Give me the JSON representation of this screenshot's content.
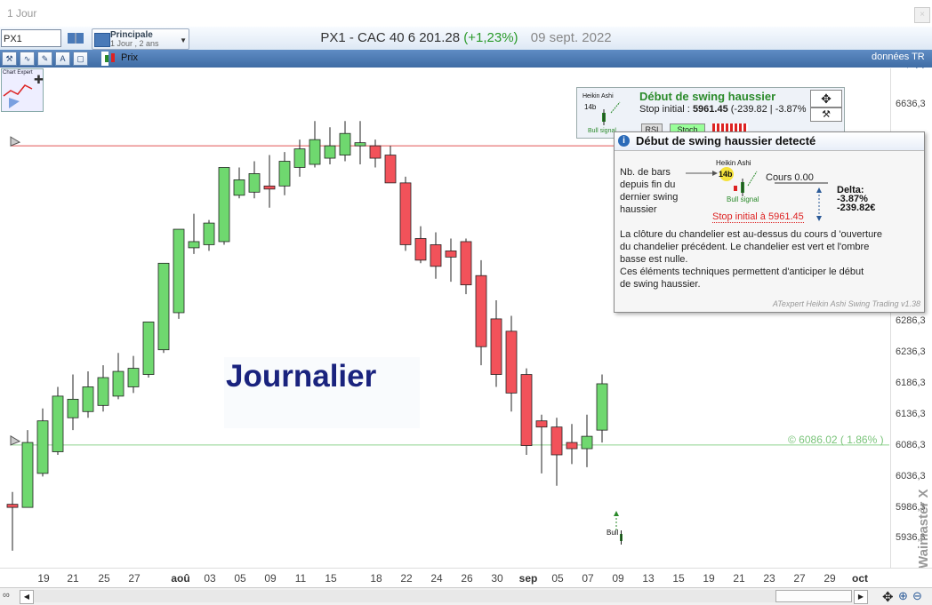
{
  "window": {
    "title": "1 Jour",
    "close_label": "×"
  },
  "toolbar": {
    "symbol": "PX1",
    "series_name": "Principale",
    "series_period": "1 Jour , 2 ans",
    "title_main": "PX1 - CAC 40  6 201.28",
    "title_change": "(+1,23%)",
    "title_date": "09 sept. 2022",
    "price_label": "Prix",
    "data_source": "données TR",
    "chart_expert_label": "Chart Expert"
  },
  "watermark": "Waimaster X",
  "annotations": {
    "journalier": "Journalier",
    "price_line_label": "© 6086.02 ( 1.86% )",
    "bull_label": "Bull"
  },
  "signal_panel": {
    "title": "Début de swing haussier",
    "stop_label": "Stop initial :",
    "stop_value": "5961.45",
    "stop_change": "(-239.82 | -3.87%",
    "mini_title": "Heikin Ashi",
    "mini_count": "14b",
    "mini_signal": "Bull signal",
    "btn_rsi": "RSI",
    "btn_stoch": "Stoch"
  },
  "popup": {
    "title": "Début de swing haussier detecté",
    "nb_bars": [
      "Nb. de bars",
      "depuis fin du",
      "dernier swing",
      "haussier"
    ],
    "mini_title": "Heikin Ashi",
    "mini_count": "14b",
    "mini_signal": "Bull signal",
    "cours": "Cours 0.00",
    "delta_label": "Delta:",
    "delta_pct": "-3.87%",
    "delta_abs": "-239.82€",
    "stop_text": "Stop initial à 5961.45",
    "description": [
      "La clôture du chandelier est au-dessus du cours d 'ouverture",
      "du chandelier précédent. Le chandelier est vert et l'ombre",
      "basse est nulle.",
      "Ces éléments techniques permettent d'anticiper le début",
      "de swing haussier."
    ],
    "footer": "ATexpert Heikin Ashi Swing Trading v1.38"
  },
  "colors": {
    "bull": "#6fd86f",
    "bear": "#f2525a",
    "outline": "#222222",
    "resistance": "#e05555",
    "support": "#8ed28e"
  },
  "chart_data": {
    "type": "candlestick",
    "y_ticks": [
      "6636,3",
      "6286,3",
      "6236,3",
      "6186,3",
      "6136,3",
      "6086,3",
      "6036,3",
      "5986,3",
      "5936,3"
    ],
    "ylim": [
      5900,
      6660
    ],
    "x_ticks": [
      "19",
      "21",
      "25",
      "27",
      "aoû",
      "03",
      "05",
      "09",
      "11",
      "15",
      "18",
      "22",
      "24",
      "26",
      "30",
      "sep",
      "05",
      "07",
      "09",
      "13",
      "15",
      "19",
      "21",
      "23",
      "27",
      "29",
      "oct"
    ],
    "levels": {
      "resistance": 6570,
      "support": 6086.02
    },
    "candles": [
      {
        "o": 5990,
        "h": 6010,
        "l": 5915,
        "c": 5985
      },
      {
        "o": 5985,
        "h": 6110,
        "l": 5985,
        "c": 6090
      },
      {
        "o": 6040,
        "h": 6145,
        "l": 6035,
        "c": 6125
      },
      {
        "o": 6075,
        "h": 6180,
        "l": 6070,
        "c": 6165
      },
      {
        "o": 6130,
        "h": 6200,
        "l": 6110,
        "c": 6160
      },
      {
        "o": 6140,
        "h": 6205,
        "l": 6130,
        "c": 6180
      },
      {
        "o": 6150,
        "h": 6215,
        "l": 6140,
        "c": 6195
      },
      {
        "o": 6165,
        "h": 6235,
        "l": 6160,
        "c": 6205
      },
      {
        "o": 6180,
        "h": 6230,
        "l": 6170,
        "c": 6210
      },
      {
        "o": 6200,
        "h": 6285,
        "l": 6195,
        "c": 6285
      },
      {
        "o": 6240,
        "h": 6360,
        "l": 6235,
        "c": 6380
      },
      {
        "o": 6300,
        "h": 6430,
        "l": 6290,
        "c": 6435
      },
      {
        "o": 6405,
        "h": 6460,
        "l": 6395,
        "c": 6415
      },
      {
        "o": 6410,
        "h": 6450,
        "l": 6400,
        "c": 6445
      },
      {
        "o": 6415,
        "h": 6535,
        "l": 6410,
        "c": 6535
      },
      {
        "o": 6490,
        "h": 6535,
        "l": 6485,
        "c": 6515
      },
      {
        "o": 6495,
        "h": 6545,
        "l": 6485,
        "c": 6525
      },
      {
        "o": 6505,
        "h": 6555,
        "l": 6470,
        "c": 6500
      },
      {
        "o": 6505,
        "h": 6560,
        "l": 6490,
        "c": 6545
      },
      {
        "o": 6535,
        "h": 6580,
        "l": 6520,
        "c": 6565
      },
      {
        "o": 6540,
        "h": 6610,
        "l": 6535,
        "c": 6580
      },
      {
        "o": 6550,
        "h": 6600,
        "l": 6540,
        "c": 6570
      },
      {
        "o": 6555,
        "h": 6610,
        "l": 6545,
        "c": 6590
      },
      {
        "o": 6570,
        "h": 6610,
        "l": 6540,
        "c": 6575
      },
      {
        "o": 6570,
        "h": 6580,
        "l": 6535,
        "c": 6550
      },
      {
        "o": 6555,
        "h": 6570,
        "l": 6520,
        "c": 6510
      },
      {
        "o": 6510,
        "h": 6520,
        "l": 6400,
        "c": 6410
      },
      {
        "o": 6420,
        "h": 6440,
        "l": 6380,
        "c": 6385
      },
      {
        "o": 6410,
        "h": 6430,
        "l": 6355,
        "c": 6375
      },
      {
        "o": 6400,
        "h": 6420,
        "l": 6350,
        "c": 6390
      },
      {
        "o": 6415,
        "h": 6420,
        "l": 6330,
        "c": 6345
      },
      {
        "o": 6360,
        "h": 6385,
        "l": 6215,
        "c": 6245
      },
      {
        "o": 6290,
        "h": 6320,
        "l": 6180,
        "c": 6200
      },
      {
        "o": 6270,
        "h": 6295,
        "l": 6140,
        "c": 6170
      },
      {
        "o": 6200,
        "h": 6210,
        "l": 6070,
        "c": 6085
      },
      {
        "o": 6125,
        "h": 6135,
        "l": 6040,
        "c": 6115
      },
      {
        "o": 6115,
        "h": 6130,
        "l": 6020,
        "c": 6070
      },
      {
        "o": 6090,
        "h": 6120,
        "l": 6055,
        "c": 6080
      },
      {
        "o": 6080,
        "h": 6135,
        "l": 6050,
        "c": 6100
      },
      {
        "o": 6110,
        "h": 6200,
        "l": 6090,
        "c": 6185
      }
    ]
  }
}
